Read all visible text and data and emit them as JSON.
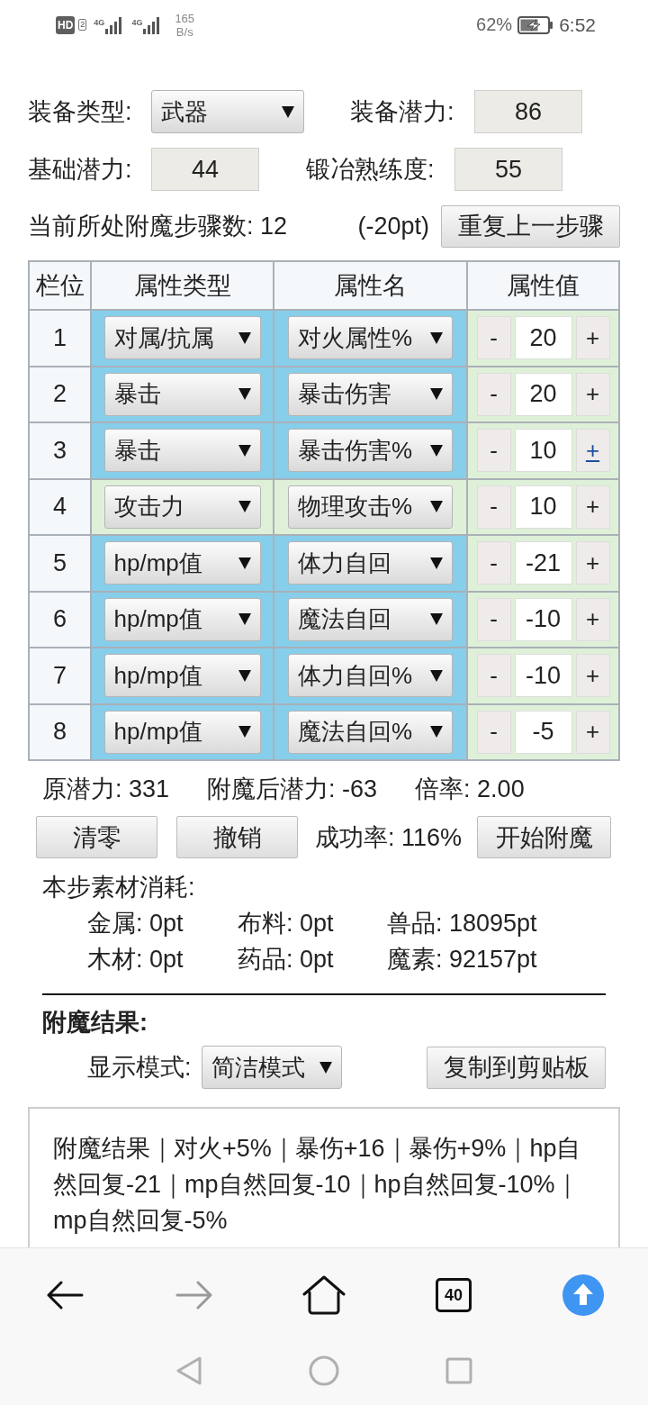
{
  "status_bar": {
    "hd_badge": "HD",
    "sim_slot": "2",
    "signals": [
      {
        "label": "4G"
      },
      {
        "label": "4G"
      }
    ],
    "speed": "165",
    "speed_unit": "B/s",
    "battery": "62%",
    "time": "6:52"
  },
  "form": {
    "equipment_type_label": "装备类型:",
    "equipment_type": "武器",
    "equipment_potential_label": "装备潜力:",
    "equipment_potential": "86",
    "base_potential_label": "基础潜力:",
    "base_potential": "44",
    "smithing_label": "锻冶熟练度:",
    "smithing": "55",
    "step_info": "当前所处附魔步骤数: 12",
    "step_cost": "(-20pt)",
    "repeat_button": "重复上一步骤"
  },
  "table": {
    "columns": [
      "栏位",
      "属性类型",
      "属性名",
      "属性值"
    ],
    "rows": [
      {
        "slot": "1",
        "type": "对属/抗属",
        "name": "对火属性%",
        "decrement": "-",
        "value": "20",
        "increment": "+",
        "increment_focused": false,
        "color": "#87ceeb"
      },
      {
        "slot": "2",
        "type": "暴击",
        "name": "暴击伤害",
        "decrement": "-",
        "value": "20",
        "increment": "+",
        "increment_focused": false,
        "color": "#87ceeb"
      },
      {
        "slot": "3",
        "type": "暴击",
        "name": "暴击伤害%",
        "decrement": "-",
        "value": "10",
        "increment": "+",
        "increment_focused": true,
        "color": "#87ceeb"
      },
      {
        "slot": "4",
        "type": "攻击力",
        "name": "物理攻击%",
        "decrement": "-",
        "value": "10",
        "increment": "+",
        "increment_focused": false,
        "color": "#dff0d8"
      },
      {
        "slot": "5",
        "type": "hp/mp值",
        "name": "体力自回",
        "decrement": "-",
        "value": "-21",
        "increment": "+",
        "increment_focused": false,
        "color": "#87ceeb"
      },
      {
        "slot": "6",
        "type": "hp/mp值",
        "name": "魔法自回",
        "decrement": "-",
        "value": "-10",
        "increment": "+",
        "increment_focused": false,
        "color": "#87ceeb"
      },
      {
        "slot": "7",
        "type": "hp/mp值",
        "name": "体力自回%",
        "decrement": "-",
        "value": "-10",
        "increment": "+",
        "increment_focused": false,
        "color": "#87ceeb"
      },
      {
        "slot": "8",
        "type": "hp/mp值",
        "name": "魔法自回%",
        "decrement": "-",
        "value": "-5",
        "increment": "+",
        "increment_focused": false,
        "color": "#87ceeb"
      }
    ]
  },
  "summary": [
    "原潜力: 331",
    "附魔后潜力: -63",
    "倍率: 2.00"
  ],
  "actions": {
    "buttons": [
      "清零",
      "撤销"
    ],
    "success_rate": "成功率: 116%",
    "start_button": "开始附魔"
  },
  "materials": {
    "title": "本步素材消耗:",
    "items": [
      "金属: 0pt",
      "布料: 0pt",
      "兽品: 18095pt",
      "木材: 0pt",
      "药品: 0pt",
      "魔素: 92157pt"
    ]
  },
  "result": {
    "heading": "附魔结果:",
    "mode_label": "显示模式:",
    "mode": "简洁模式",
    "copy_button": "复制到剪贴板",
    "text": "附魔结果｜对火+5%｜暴伤+16｜暴伤+9%｜hp自然回复-21｜mp自然回复-10｜hp自然回复-10%｜mp自然回复-5%"
  },
  "browser_nav": {
    "back_enabled": true,
    "forward_enabled": false,
    "tab_count": "40"
  }
}
